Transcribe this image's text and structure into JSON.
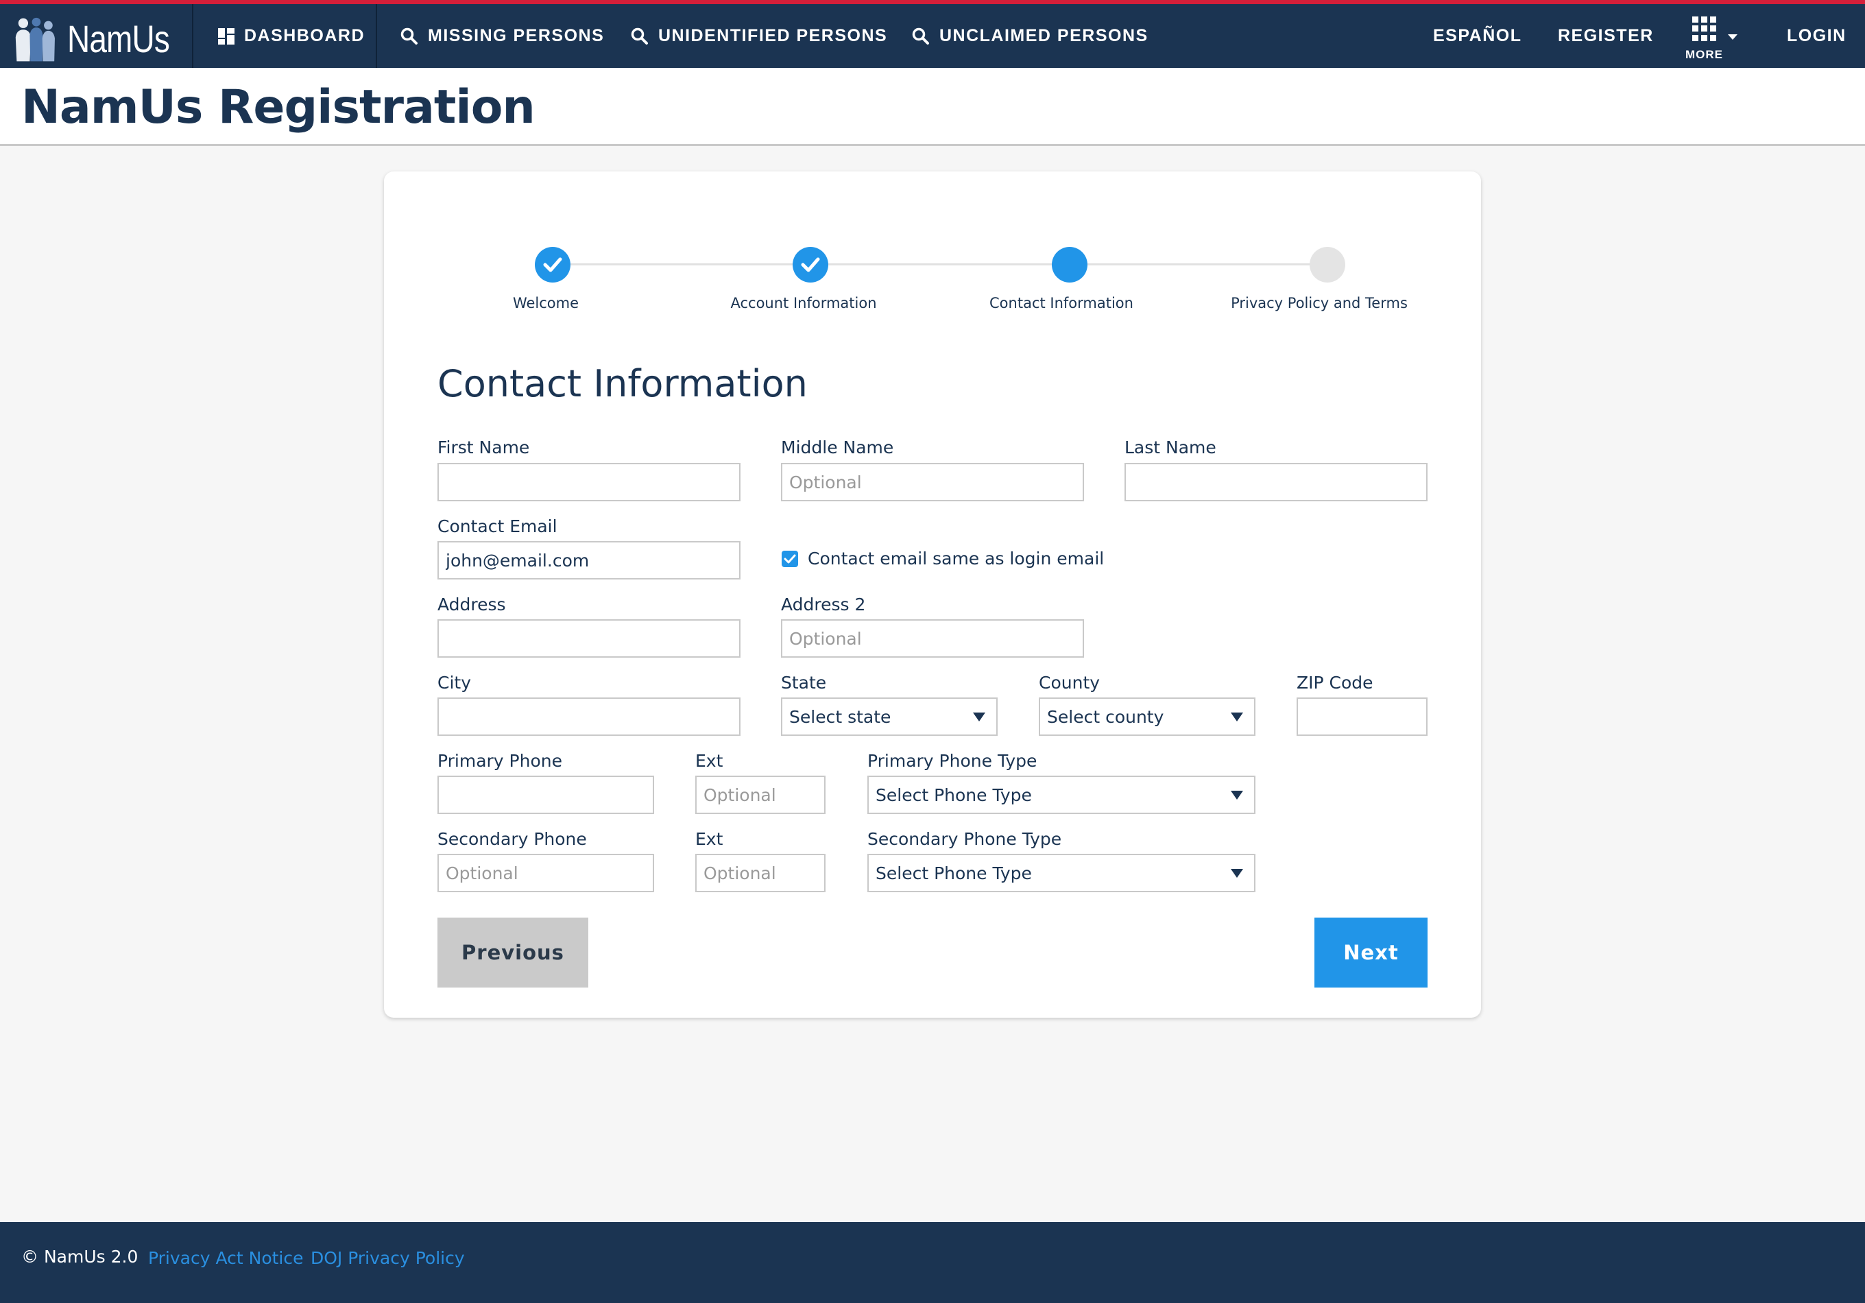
{
  "header": {
    "logo_text": "NamUs",
    "nav": {
      "dashboard": "DASHBOARD",
      "missing": "MISSING PERSONS",
      "unidentified": "UNIDENTIFIED PERSONS",
      "unclaimed": "UNCLAIMED PERSONS",
      "espanol": "ESPAÑOL",
      "register": "REGISTER",
      "more": "MORE",
      "login": "LOGIN"
    },
    "icons": {
      "dashboard": "dashboard-icon",
      "search": "search-icon",
      "more": "grid-icon"
    },
    "accent_color": "#d41f3a",
    "bar_color": "#1b3452"
  },
  "page": {
    "title": "NamUs Registration"
  },
  "stepper": {
    "steps": [
      {
        "label": "Welcome",
        "state": "complete"
      },
      {
        "label": "Account Information",
        "state": "complete"
      },
      {
        "label": "Contact Information",
        "state": "current"
      },
      {
        "label": "Privacy Policy and Terms",
        "state": "upcoming"
      }
    ],
    "active_color": "#2195e8"
  },
  "form": {
    "section_title": "Contact Information",
    "first_name": {
      "label": "First Name",
      "value": "",
      "placeholder": ""
    },
    "middle_name": {
      "label": "Middle Name",
      "value": "",
      "placeholder": "Optional"
    },
    "last_name": {
      "label": "Last Name",
      "value": "",
      "placeholder": ""
    },
    "contact_email": {
      "label": "Contact Email",
      "value": "john@email.com"
    },
    "same_as_login": {
      "label": "Contact email same as login email",
      "checked": true
    },
    "address": {
      "label": "Address",
      "value": "",
      "placeholder": ""
    },
    "address2": {
      "label": "Address 2",
      "value": "",
      "placeholder": "Optional"
    },
    "city": {
      "label": "City",
      "value": ""
    },
    "state": {
      "label": "State",
      "selected": "Select state"
    },
    "county": {
      "label": "County",
      "selected": "Select county"
    },
    "zip": {
      "label": "ZIP Code",
      "value": ""
    },
    "primary_phone": {
      "label": "Primary Phone",
      "value": ""
    },
    "primary_ext": {
      "label": "Ext",
      "placeholder": "Optional"
    },
    "primary_type": {
      "label": "Primary Phone Type",
      "selected": "Select Phone Type"
    },
    "secondary_phone": {
      "label": "Secondary Phone",
      "placeholder": "Optional"
    },
    "secondary_ext": {
      "label": "Ext",
      "placeholder": "Optional"
    },
    "secondary_type": {
      "label": "Secondary Phone Type",
      "selected": "Select Phone Type"
    },
    "previous_label": "Previous",
    "next_label": "Next"
  },
  "footer": {
    "copyright": "© NamUs 2.0",
    "privacy_act": "Privacy Act Notice",
    "doj_privacy": "DOJ Privacy Policy"
  }
}
